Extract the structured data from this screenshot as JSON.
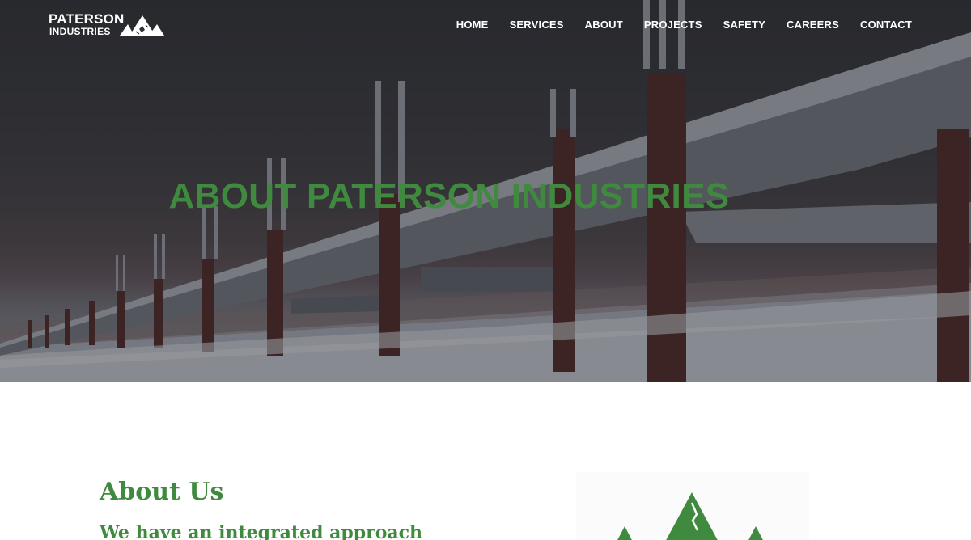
{
  "brand": {
    "line1": "PATERSON",
    "line2": "INDUSTRIES",
    "logo_icon": "mountain-logo-icon"
  },
  "nav": {
    "items": [
      {
        "label": "HOME"
      },
      {
        "label": "SERVICES"
      },
      {
        "label": "ABOUT"
      },
      {
        "label": "PROJECTS"
      },
      {
        "label": "SAFETY"
      },
      {
        "label": "CAREERS"
      },
      {
        "label": "CONTACT"
      }
    ]
  },
  "hero": {
    "title": "ABOUT PATERSON INDUSTRIES",
    "image": "pipeline-in-snow-photo"
  },
  "about": {
    "heading": "About Us",
    "subheading": "We have an integrated approach",
    "image": "green-mountain-logo"
  },
  "colors": {
    "accent_green": "#3f8a3f",
    "nav_text": "#ffffff"
  }
}
